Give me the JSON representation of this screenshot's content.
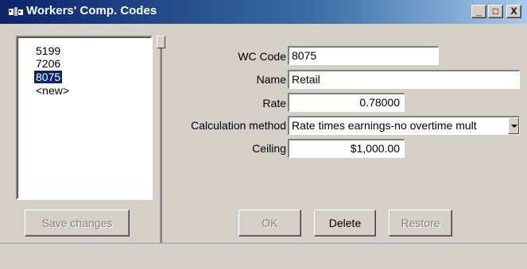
{
  "window": {
    "title": "Workers' Comp. Codes",
    "controls": {
      "minimize": "_",
      "maximize": "□",
      "close": "X"
    },
    "icon": "app-icon"
  },
  "codes_list": {
    "items": [
      "5199",
      "7206",
      "8075",
      "<new>"
    ],
    "selected": "8075"
  },
  "form": {
    "wc_code": {
      "label": "WC Code",
      "value": "8075"
    },
    "name": {
      "label": "Name",
      "value": "Retail"
    },
    "rate": {
      "label": "Rate",
      "value": "0.78000"
    },
    "calculation_method": {
      "label": "Calculation method",
      "value": "Rate times earnings-no overtime mult"
    },
    "ceiling": {
      "label": "Ceiling",
      "value": "$1,000.00"
    }
  },
  "buttons": {
    "save_changes": "Save changes",
    "ok": "OK",
    "delete": "Delete",
    "restore": "Restore"
  },
  "colors": {
    "titlebar_start": "#0a246a",
    "titlebar_end": "#a6caf0",
    "selection": "#0a246a",
    "face": "#d4d0c8"
  }
}
